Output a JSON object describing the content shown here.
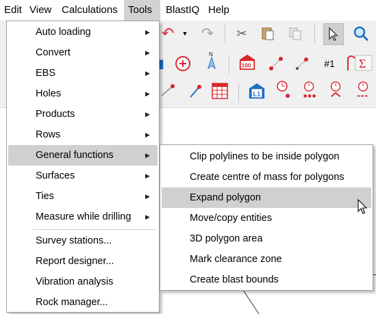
{
  "menubar": {
    "items": [
      {
        "label": "Edit"
      },
      {
        "label": "View"
      },
      {
        "label": "Calculations"
      },
      {
        "label": "Tools"
      },
      {
        "label": "BlastIQ"
      },
      {
        "label": "Help"
      }
    ],
    "active": "Tools"
  },
  "toolbar": {
    "icons": [
      "undo-icon",
      "dropdown-arrow-icon",
      "redo-icon",
      "cut-icon",
      "paste-icon",
      "copy-icon",
      "pointer-icon",
      "zoom-icon",
      "add-point-icon",
      "north-marker-icon",
      "hole-100-icon",
      "hole-line-icon",
      "hole-arrow-icon",
      "number-one-icon",
      "sigma-icon",
      "hole-pair-icon",
      "hole-angle-icon",
      "table-icon",
      "level-one-icon",
      "timing-icon"
    ],
    "labels": {
      "hole_100": "100",
      "number_one": "#1",
      "level_one": "L1",
      "sigma": "Σ"
    }
  },
  "tools_menu": {
    "items": [
      {
        "label": "Auto loading",
        "submenu": true
      },
      {
        "label": "Convert",
        "submenu": true
      },
      {
        "label": "EBS",
        "submenu": true
      },
      {
        "label": "Holes",
        "submenu": true
      },
      {
        "label": "Products",
        "submenu": true
      },
      {
        "label": "Rows",
        "submenu": true
      },
      {
        "label": "General functions",
        "submenu": true,
        "highlighted": true
      },
      {
        "label": "Surfaces",
        "submenu": true
      },
      {
        "label": "Ties",
        "submenu": true
      },
      {
        "label": "Measure while drilling",
        "submenu": true
      },
      {
        "label": "Survey stations...",
        "submenu": false
      },
      {
        "label": "Report designer...",
        "submenu": false
      },
      {
        "label": "Vibration analysis",
        "submenu": false
      },
      {
        "label": "Rock manager...",
        "submenu": false
      }
    ]
  },
  "general_functions_menu": {
    "items": [
      {
        "label": "Clip polylines to be inside polygon"
      },
      {
        "label": "Create centre of mass for polygons"
      },
      {
        "label": "Expand polygon",
        "highlighted": true
      },
      {
        "label": "Move/copy entities"
      },
      {
        "label": "3D polygon area"
      },
      {
        "label": "Mark clearance zone"
      },
      {
        "label": "Create blast bounds"
      }
    ]
  },
  "colors": {
    "accent_red": "#d9262c",
    "accent_blue": "#1d6fc1",
    "highlight": "#d0d0d0"
  }
}
